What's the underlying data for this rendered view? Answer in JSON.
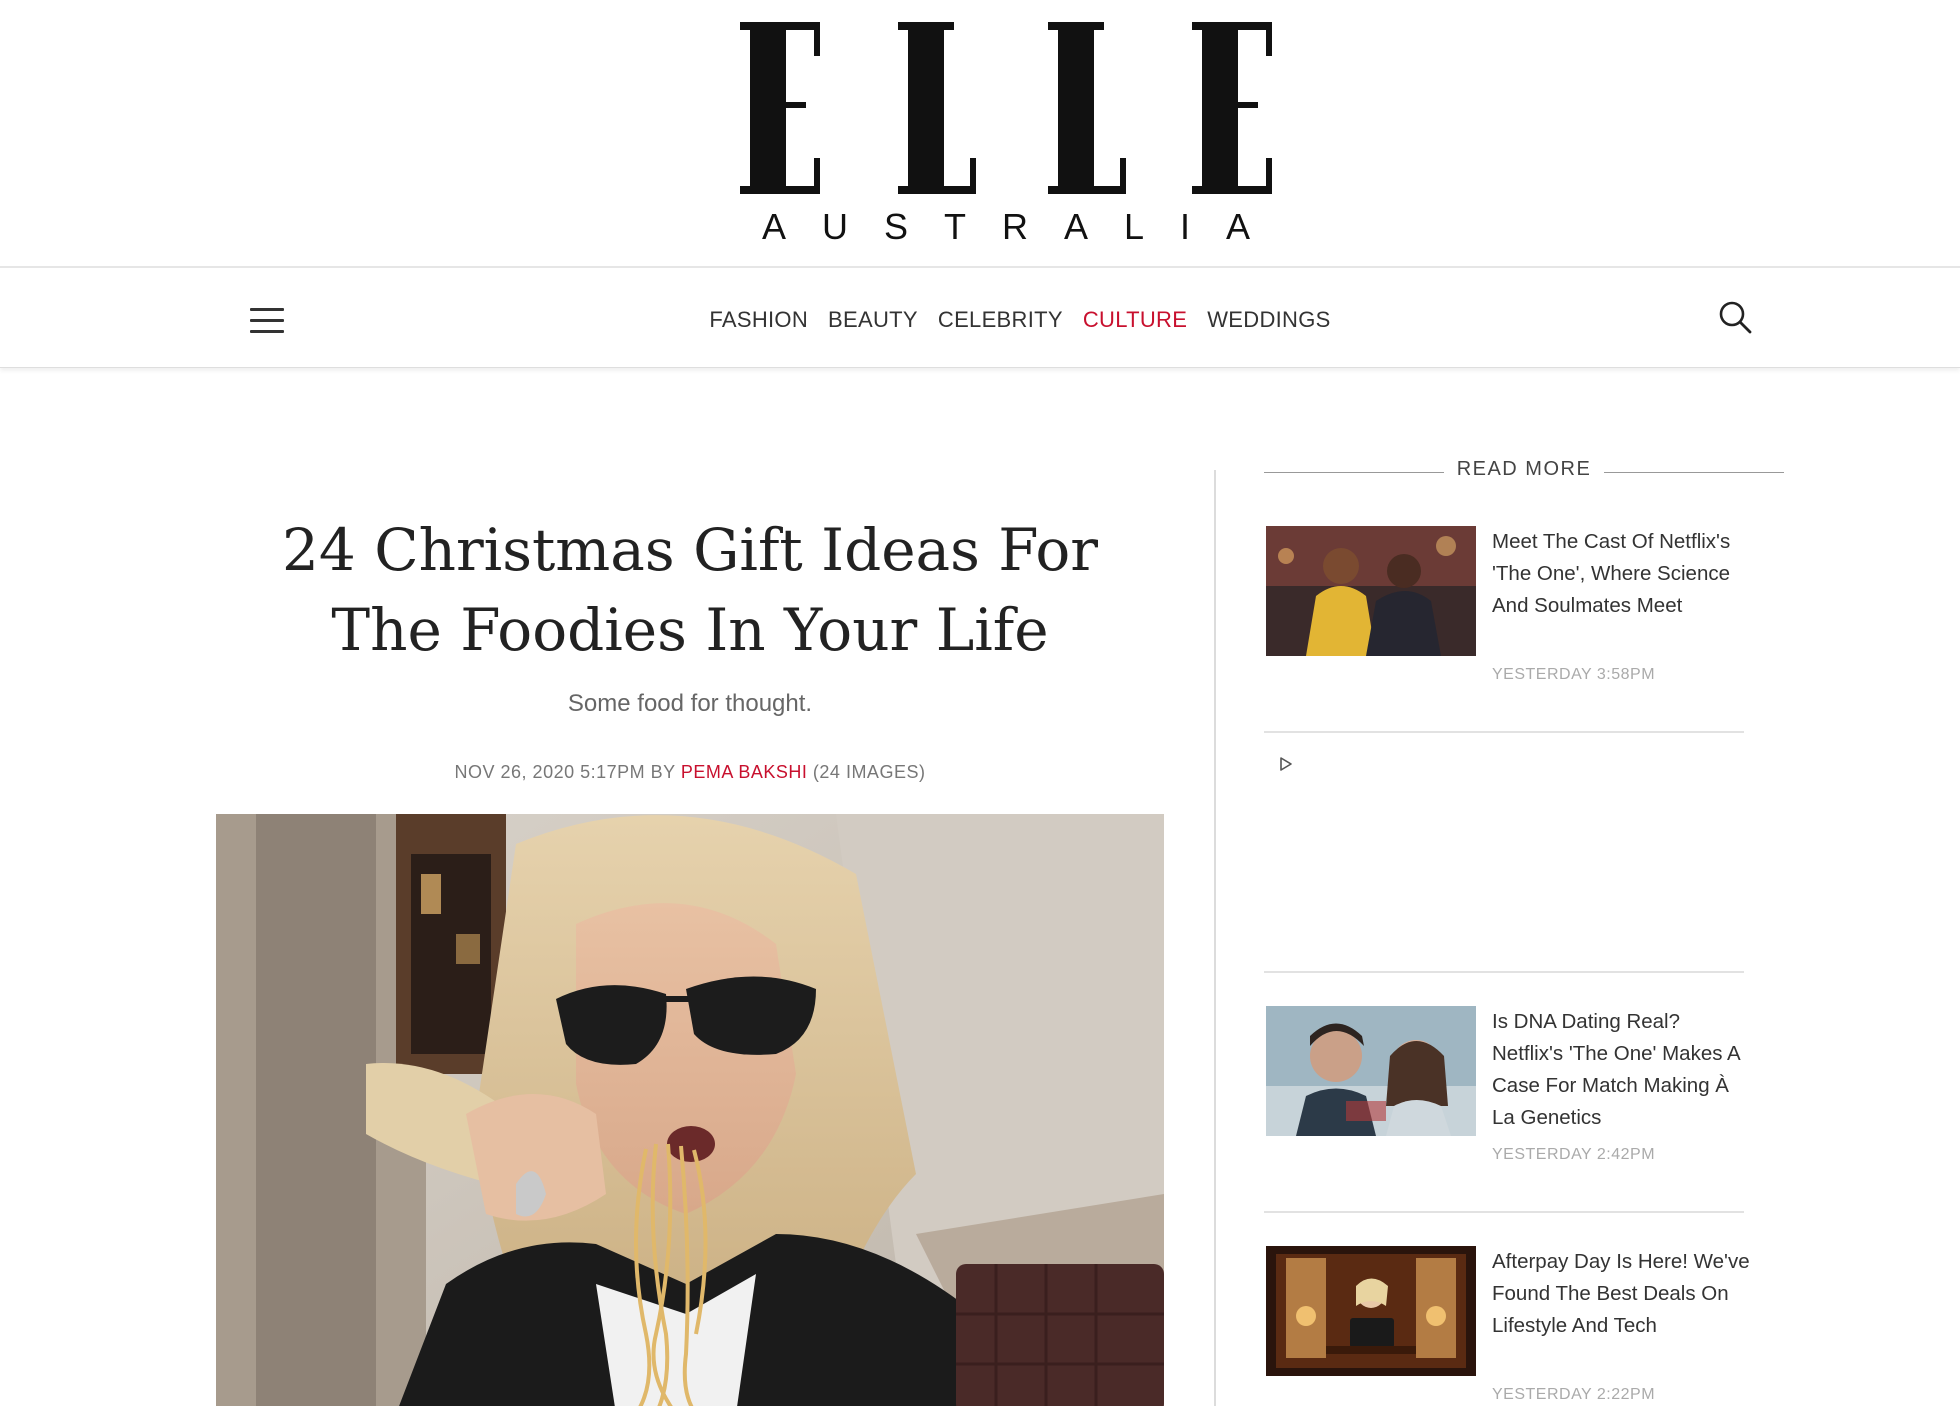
{
  "brand": {
    "logo_main": "ELLE",
    "logo_sub": "AUSTRALIA"
  },
  "nav": {
    "items": [
      {
        "label": "FASHION"
      },
      {
        "label": "BEAUTY"
      },
      {
        "label": "CELEBRITY"
      },
      {
        "label": "CULTURE",
        "active": true
      },
      {
        "label": "WEDDINGS"
      }
    ],
    "menu_icon": "hamburger-menu-icon",
    "search_icon": "search-icon",
    "active_color": "#c8102e"
  },
  "article": {
    "headline_line1": "24 Christmas Gift Ideas For",
    "headline_line2": "The Foodies In Your Life",
    "dek": "Some food for thought.",
    "date": "NOV 26, 2020 5:17PM",
    "by": "BY",
    "author": "PEMA BAKSHI",
    "image_count": "(24 IMAGES)"
  },
  "sidebar": {
    "heading": "READ MORE",
    "cards": [
      {
        "title": "Meet The Cast Of Netflix's 'The One', Where Science And Soulmates Meet",
        "time": "YESTERDAY 3:58PM"
      },
      {
        "title": "Is DNA Dating Real? Netflix's 'The One' Makes A Case For Match Making À La Genetics",
        "time": "YESTERDAY 2:42PM"
      },
      {
        "title": "Afterpay Day Is Here! We've Found The Best Deals On Lifestyle And Tech",
        "time": "YESTERDAY 2:22PM"
      }
    ],
    "ad_icon": "play-icon"
  }
}
